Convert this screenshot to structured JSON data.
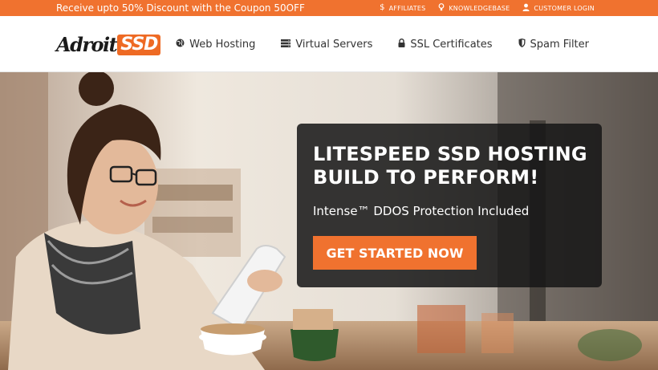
{
  "colors": {
    "accent": "#f0722f",
    "panel": "#161616",
    "text_dark": "#333333"
  },
  "topbar": {
    "promo": "Receive upto 50% Discount with the Coupon 50OFF",
    "links": [
      {
        "icon": "dollar-icon",
        "glyph": "$",
        "label": "AFFILIATES"
      },
      {
        "icon": "lightbulb-icon",
        "glyph": "⚲",
        "label": "KNOWLEDGEBASE"
      },
      {
        "icon": "user-icon",
        "glyph": "👤",
        "label": "CUSTOMER LOGIN"
      }
    ]
  },
  "header": {
    "logo_word": "Adroit",
    "logo_badge": "SSD",
    "nav": [
      {
        "icon": "globe-icon",
        "glyph": "🌐",
        "label": "Web Hosting"
      },
      {
        "icon": "server-icon",
        "glyph": "☰",
        "label": "Virtual Servers"
      },
      {
        "icon": "lock-icon",
        "glyph": "🔒",
        "label": "SSL Certificates"
      },
      {
        "icon": "shield-icon",
        "glyph": "⛉",
        "label": "Spam Filter"
      }
    ]
  },
  "hero": {
    "headline_line1": "LITESPEED SSD HOSTING",
    "headline_line2": "BUILD TO PERFORM!",
    "subline": "Intense™ DDOS Protection Included",
    "cta": "GET STARTED NOW"
  }
}
